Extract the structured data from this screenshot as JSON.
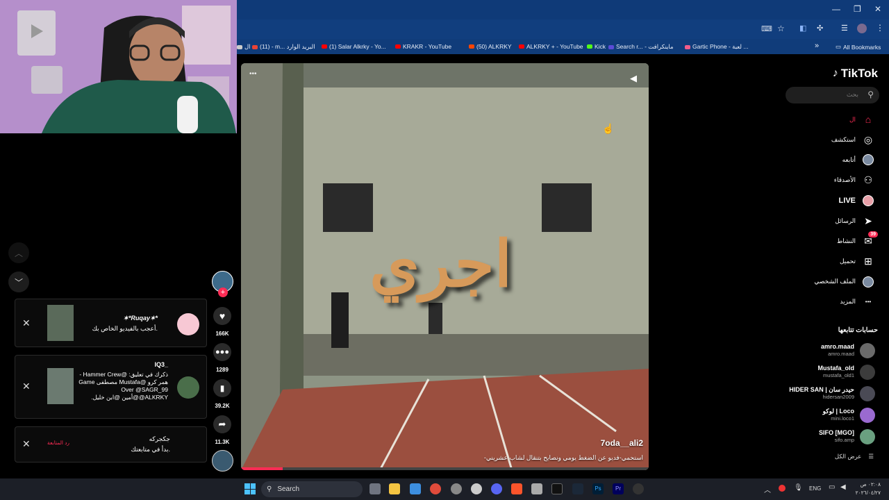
{
  "browser": {
    "bookmarks": [
      {
        "label": "ال",
        "color": "#cccccc"
      },
      {
        "label": "(11) - m... البريد الوارد",
        "color": "#ea4335"
      },
      {
        "label": "(1) Salar Alkrky - Yo...",
        "color": "#ff0000"
      },
      {
        "label": "KRAKR - YouTube",
        "color": "#ff0000"
      },
      {
        "label": "(50) ALKRKY",
        "color": "#ff4500"
      },
      {
        "label": "ALKRKY + - YouTube",
        "color": "#ff0000"
      },
      {
        "label": "Kick",
        "color": "#53fc18"
      },
      {
        "label": "Search r... - ماينكرافت",
        "color": "#5b4bd6"
      },
      {
        "label": "Gartic Phone - لعبة ...",
        "color": "#f25c8a"
      }
    ],
    "all_bookmarks_label": "All Bookmarks",
    "more_bookmarks_glyph": "»"
  },
  "tiktok": {
    "logo_text": "TikTok",
    "search_placeholder": "بحث",
    "nav": [
      {
        "label": "ال",
        "icon": "home-icon",
        "active": true
      },
      {
        "label": "استكشف",
        "icon": "compass-icon"
      },
      {
        "label": "أتابعه",
        "icon": "avatar-icon"
      },
      {
        "label": "الأصدقاء",
        "icon": "friends-icon"
      },
      {
        "label": "LIVE",
        "icon": "live-icon"
      },
      {
        "label": "الرسائل",
        "icon": "send-icon"
      },
      {
        "label": "النشاط",
        "icon": "inbox-icon",
        "badge": "39"
      },
      {
        "label": "تحميل",
        "icon": "upload-icon"
      },
      {
        "label": "الملف الشخصي",
        "icon": "profile-icon"
      },
      {
        "label": "المزيد",
        "icon": "more-icon"
      }
    ],
    "following_title": "حسابات تتابعها",
    "following": [
      {
        "name": "amro.maad",
        "handle": "amro.maad"
      },
      {
        "name": "Mustafa_old",
        "handle": "mustafa_old1"
      },
      {
        "name": "HIDER SAN | حيدر سان",
        "handle": "hidersan2009"
      },
      {
        "name": "لوكو | Loco",
        "handle": "mini.loco1"
      },
      {
        "name": "SIFO [MGO]",
        "handle": "sifo.amp"
      }
    ],
    "see_all": "عرض الكل",
    "video": {
      "author": "7oda__ali2",
      "caption": "-استحمي-فديو عن الضغط يومي ونصايح بتنقال لشاب عشريني",
      "overlay_text": "اجري",
      "more_glyph": "•••"
    },
    "actions": {
      "likes": "166K",
      "comments": "1289",
      "saves": "39.2K",
      "shares": "11.3K"
    },
    "notifications": [
      {
        "title": "✶*Ruqay✶*",
        "body": "أعجب بالفيديو الخاص بك."
      },
      {
        "title": "IQ3_",
        "body": "ذكرك في تعليق: @Hammer Crew - همر كرو @Mustafa مصطفى Game Over @SAGR_99 @ALKRKY@أمين @ابن خليل."
      },
      {
        "title": "جكجركه",
        "body": "بدأ في متابعتك.",
        "action": "رد المتابعة"
      }
    ]
  },
  "taskbar": {
    "search_label": "Search",
    "lang": "ENG",
    "time": "٠٢:٠٨ ص",
    "date": "٢٠٢٦/٠٤/٢٧"
  }
}
